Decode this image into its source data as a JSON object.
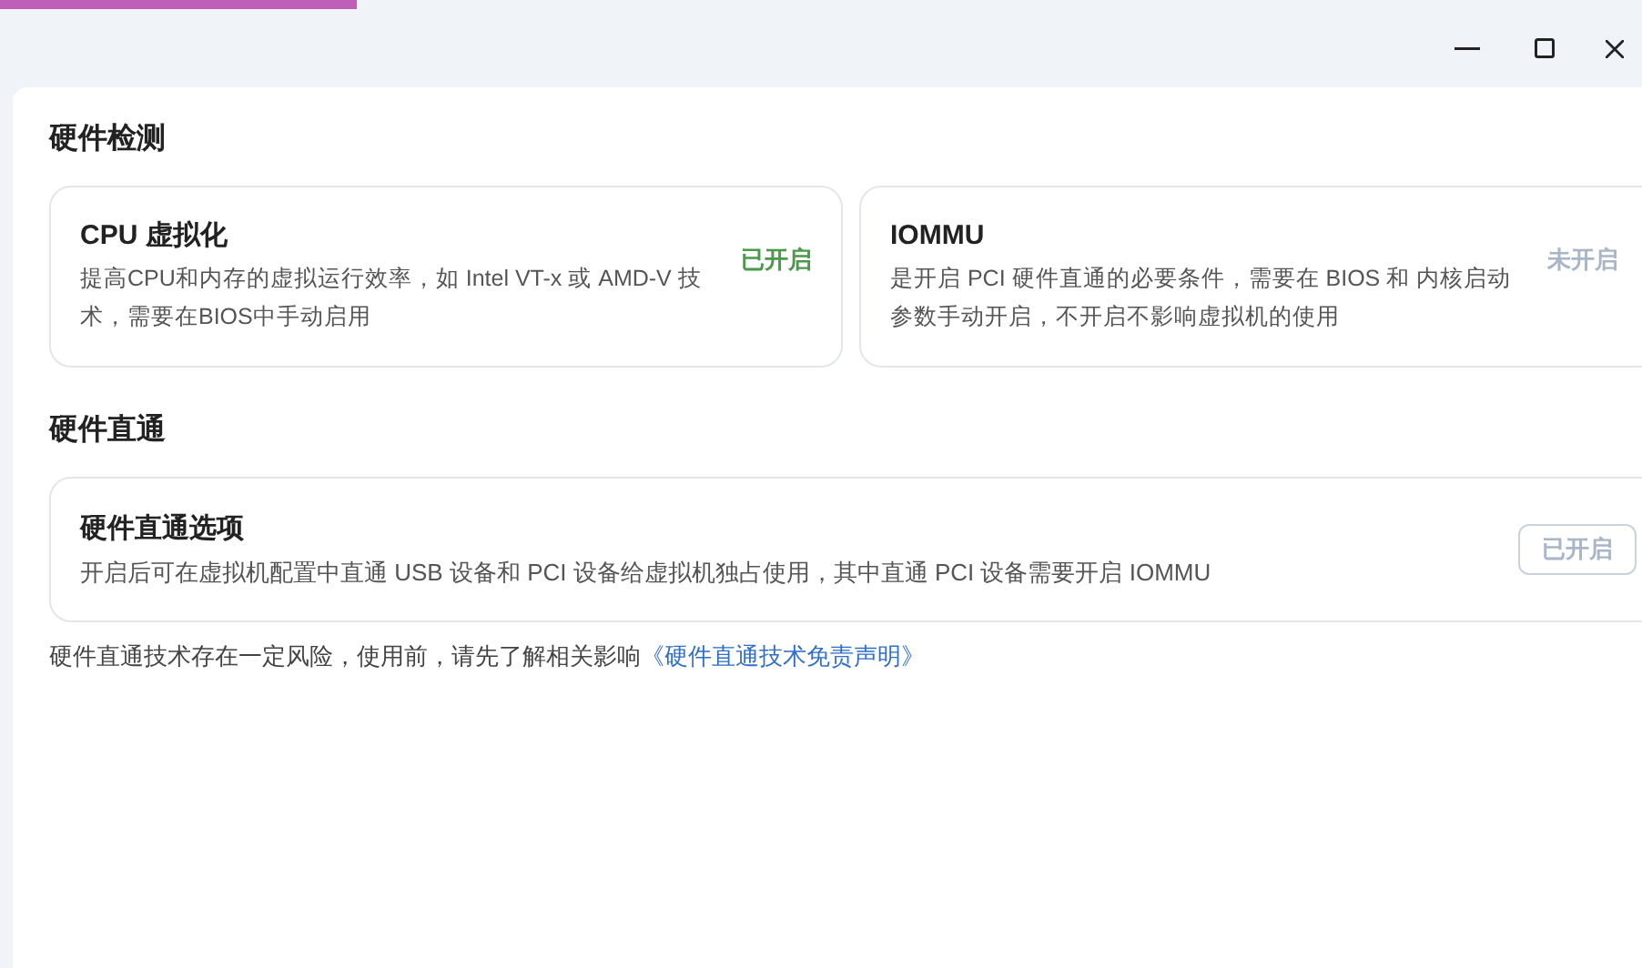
{
  "detection": {
    "title": "硬件检测",
    "items": [
      {
        "name": "CPU 虚拟化",
        "description": "提高CPU和内存的虚拟运行效率，如 Intel VT-x 或 AMD-V 技术，需要在BIOS中手动启用",
        "status": "已开启",
        "enabled": true
      },
      {
        "name": "IOMMU",
        "description": "是开启 PCI 硬件直通的必要条件，需要在 BIOS 和 内核启动参数手动开启，不开启不影响虚拟机的使用",
        "status": "未开启",
        "enabled": false
      }
    ]
  },
  "passthrough": {
    "title": "硬件直通",
    "option": {
      "name": "硬件直通选项",
      "description": "开启后可在虚拟机配置中直通 USB 设备和 PCI 设备给虚拟机独占使用，其中直通 PCI 设备需要开启 IOMMU",
      "button": "已开启",
      "disabled": true
    },
    "notice": "硬件直通技术存在一定风险，使用前，请先了解相关影响",
    "link": "《硬件直通技术免责声明》"
  }
}
